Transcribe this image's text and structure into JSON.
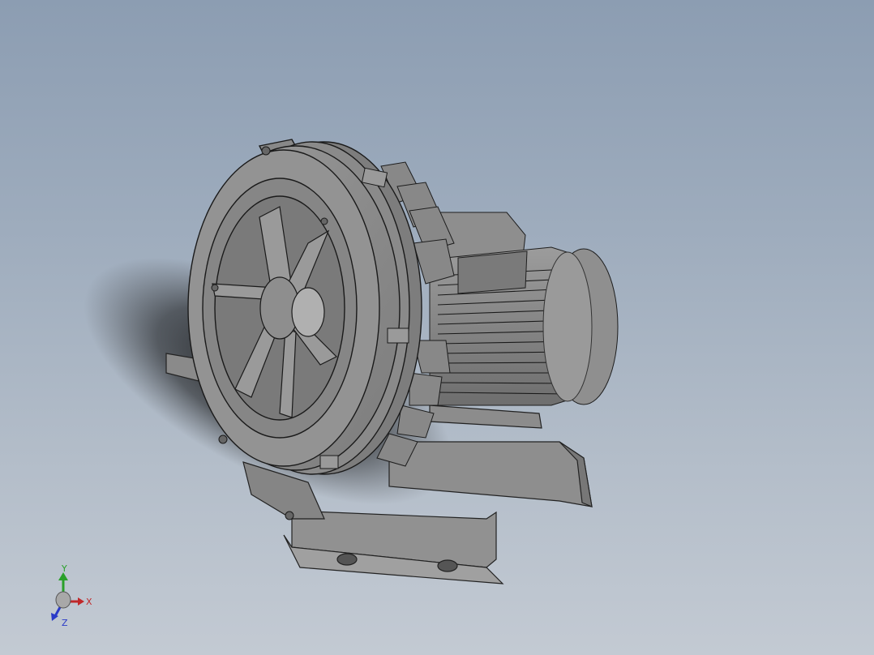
{
  "viewport": {
    "background_top": "#8c9db2",
    "background_bottom": "#c3cad3",
    "model_color": "#8f8f8f",
    "edge_color": "#2a2a2a"
  },
  "triad": {
    "x_label": "X",
    "y_label": "Y",
    "z_label": "Z",
    "x_color": "#c0282a",
    "y_color": "#2aa02a",
    "z_color": "#2a3ac8"
  }
}
